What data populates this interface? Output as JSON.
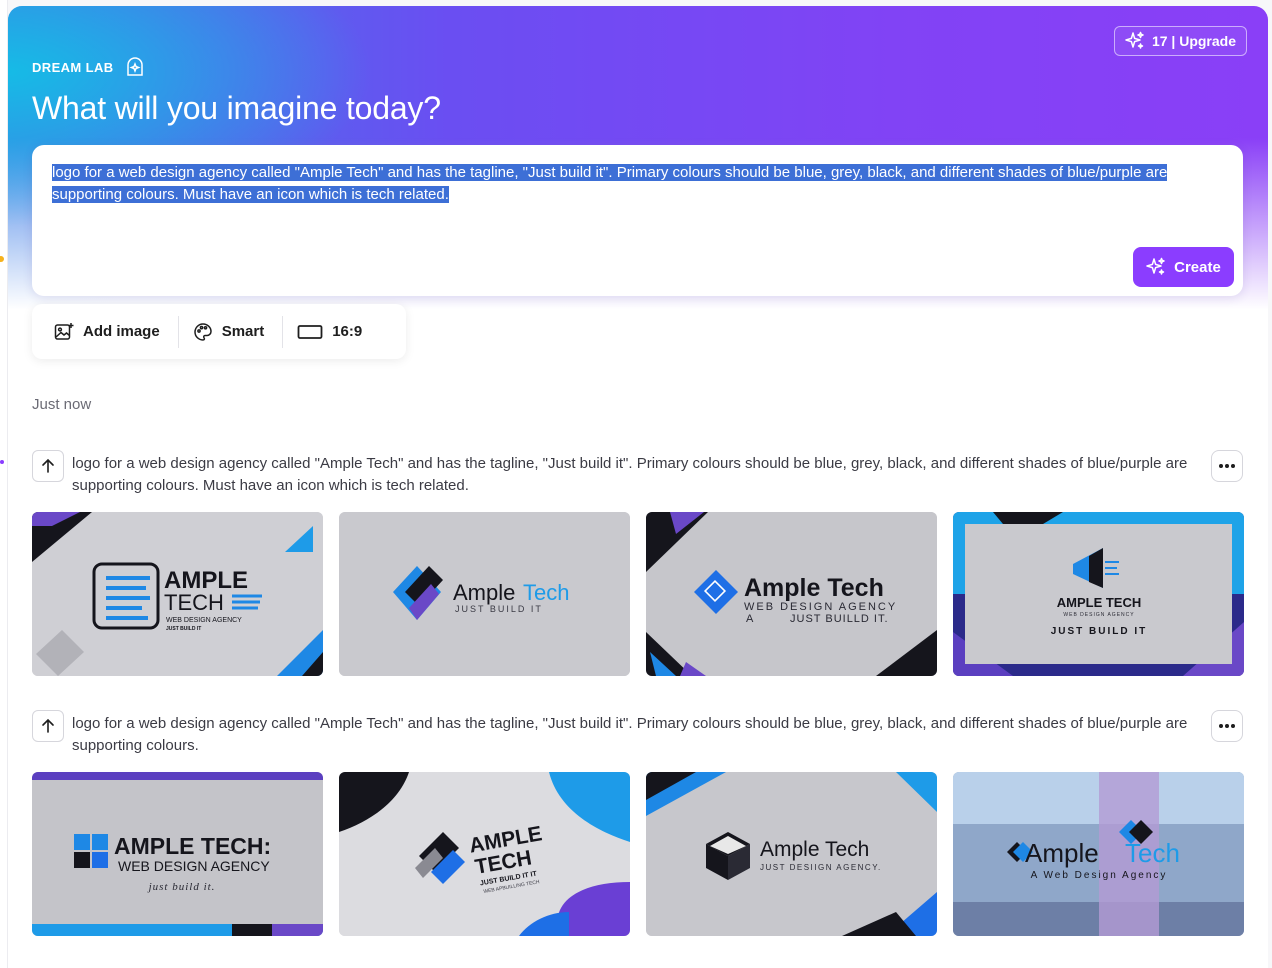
{
  "header": {
    "brand": "DREAM LAB",
    "headline": "What will you imagine today?",
    "upgrade_label": "17 | Upgrade"
  },
  "prompt_input": {
    "value": "logo for a web design agency called \"Ample Tech\" and has the tagline, \"Just build it\". Primary colours should be blue, grey, black, and different shades of blue/purple are supporting colours. Must have an icon which is tech related."
  },
  "create_label": "Create",
  "options": {
    "add_image": "Add image",
    "style": "Smart",
    "aspect_ratio": "16:9"
  },
  "history_label": "Just now",
  "generations": [
    {
      "prompt": "logo for a web design agency called \"Ample Tech\" and has the tagline, \"Just build it\". Primary colours should be blue, grey, black, and different shades of blue/purple are supporting colours. Must have an icon which is tech related.",
      "images": [
        {
          "line1": "AMPLE",
          "line2": "TECH",
          "line3": "WEB DESIGN AGENCY",
          "line4": "JUST BUILD IT"
        },
        {
          "line1": "Ample",
          "line2": "Tech",
          "line3": "JUST BUILD IT"
        },
        {
          "line1": "Ample Tech",
          "line2": "WEB DESIGN AGENCY",
          "line3": "A",
          "line4": "JUST BUILLD IT."
        },
        {
          "line1": "AMPLE TECH",
          "line2": "WEB DESIGN AGENCY",
          "line3": "JUST BUILD IT"
        }
      ]
    },
    {
      "prompt": "logo for a web design agency called \"Ample Tech\" and has the tagline, \"Just build it\". Primary colours should be blue, grey, black, and different shades of blue/purple are supporting colours.",
      "images": [
        {
          "line1": "AMPLE TECH:",
          "line2": "WEB DESIGN AGENCY",
          "line3": "just build it."
        },
        {
          "line1": "AMPLE",
          "line2": "TECH",
          "line3": "JUST BUILD IT IT",
          "line4": "WEB APBUILLING TECH"
        },
        {
          "line1": "Ample Tech",
          "line2": "JUST DESIIGN AGENCY."
        },
        {
          "line1": "Ample",
          "line2": "Tech",
          "line3": "A Web Design Agency"
        }
      ]
    }
  ],
  "colors": {
    "accent": "#8b3dff",
    "selection": "#3d6fd6",
    "brand_blue": "#1e88e5",
    "dark": "#15151c"
  }
}
